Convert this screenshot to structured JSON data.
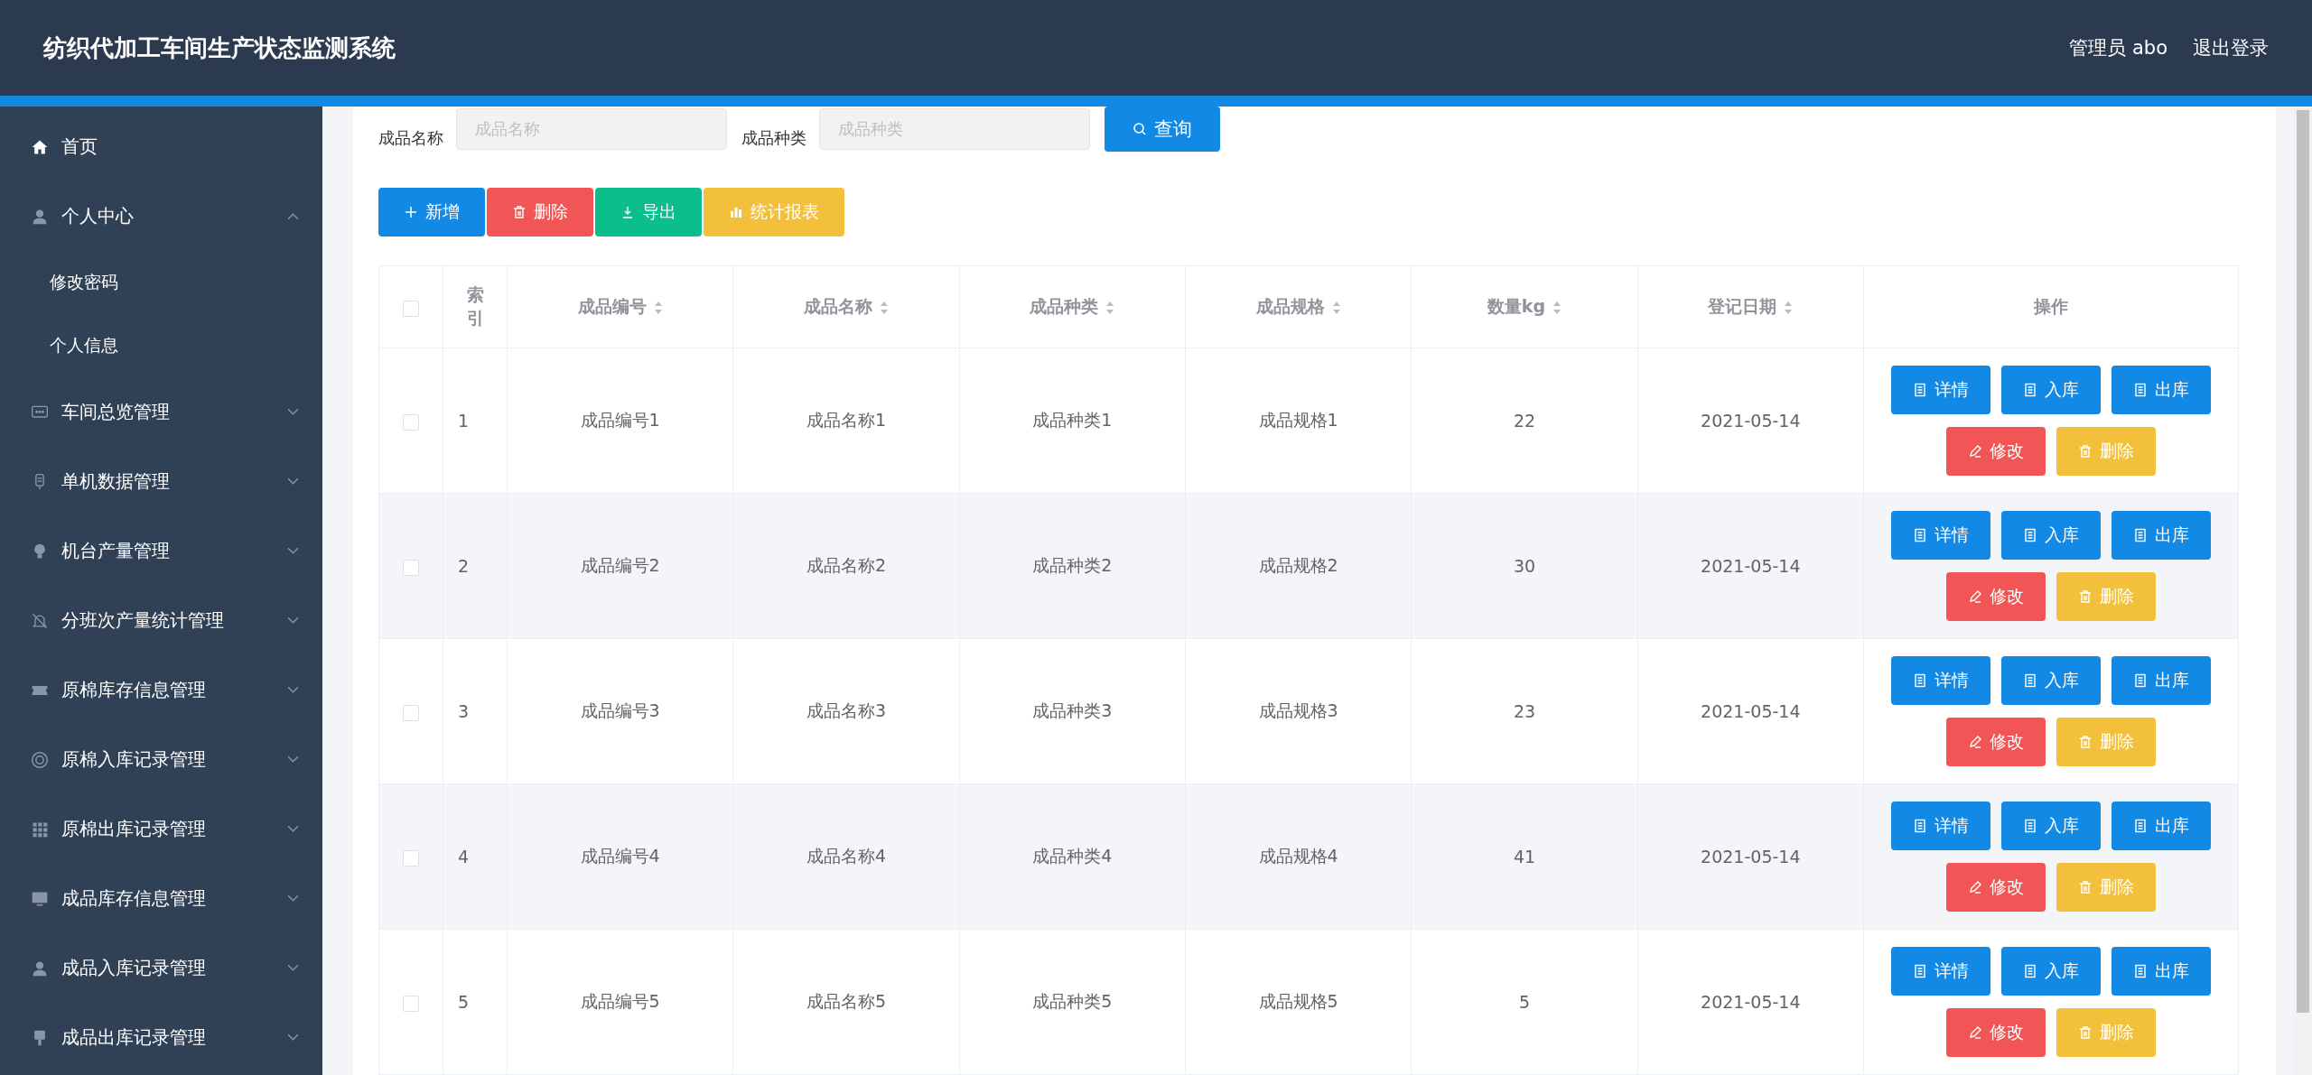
{
  "header": {
    "title": "纺织代加工车间生产状态监测系统",
    "user": "管理员 abo",
    "logout": "退出登录"
  },
  "sidebar": {
    "items": [
      {
        "label": "首页"
      },
      {
        "label": "个人中心",
        "expanded": true,
        "children": [
          {
            "label": "修改密码"
          },
          {
            "label": "个人信息"
          }
        ]
      },
      {
        "label": "车间总览管理",
        "expanded": false
      },
      {
        "label": "单机数据管理",
        "expanded": false
      },
      {
        "label": "机台产量管理",
        "expanded": false
      },
      {
        "label": "分班次产量统计管理",
        "expanded": false
      },
      {
        "label": "原棉库存信息管理",
        "expanded": false
      },
      {
        "label": "原棉入库记录管理",
        "expanded": false
      },
      {
        "label": "原棉出库记录管理",
        "expanded": false
      },
      {
        "label": "成品库存信息管理",
        "expanded": false
      },
      {
        "label": "成品入库记录管理",
        "expanded": false
      },
      {
        "label": "成品出库记录管理",
        "expanded": false
      }
    ]
  },
  "search": {
    "fields": [
      {
        "label": "成品名称",
        "placeholder": "成品名称"
      },
      {
        "label": "成品种类",
        "placeholder": "成品种类"
      }
    ],
    "button": "查询"
  },
  "toolbar": [
    {
      "label": "新增",
      "kind": "add"
    },
    {
      "label": "删除",
      "kind": "delete"
    },
    {
      "label": "导出",
      "kind": "export"
    },
    {
      "label": "统计报表",
      "kind": "report"
    }
  ],
  "table": {
    "select_all": {
      "checked": false
    },
    "columns": [
      {
        "label": "索引",
        "sortable": false
      },
      {
        "label": "成品编号",
        "sortable": true
      },
      {
        "label": "成品名称",
        "sortable": true
      },
      {
        "label": "成品种类",
        "sortable": true
      },
      {
        "label": "成品规格",
        "sortable": true
      },
      {
        "label": "数量kg",
        "sortable": true
      },
      {
        "label": "登记日期",
        "sortable": true
      },
      {
        "label": "操作",
        "sortable": false
      }
    ],
    "rows": [
      {
        "checked": false,
        "cells": [
          "1",
          "成品编号1",
          "成品名称1",
          "成品种类1",
          "成品规格1",
          "22",
          "2021-05-14"
        ],
        "actions": [
          {
            "label": "详情",
            "kind": "doc"
          },
          {
            "label": "入库",
            "kind": "doc"
          },
          {
            "label": "出库",
            "kind": "doc"
          },
          {
            "label": "修改",
            "kind": "edit"
          },
          {
            "label": "删除",
            "kind": "delete"
          }
        ]
      },
      {
        "checked": false,
        "cells": [
          "2",
          "成品编号2",
          "成品名称2",
          "成品种类2",
          "成品规格2",
          "30",
          "2021-05-14"
        ],
        "actions": [
          {
            "label": "详情",
            "kind": "doc"
          },
          {
            "label": "入库",
            "kind": "doc"
          },
          {
            "label": "出库",
            "kind": "doc"
          },
          {
            "label": "修改",
            "kind": "edit"
          },
          {
            "label": "删除",
            "kind": "delete"
          }
        ]
      },
      {
        "checked": false,
        "cells": [
          "3",
          "成品编号3",
          "成品名称3",
          "成品种类3",
          "成品规格3",
          "23",
          "2021-05-14"
        ],
        "actions": [
          {
            "label": "详情",
            "kind": "doc"
          },
          {
            "label": "入库",
            "kind": "doc"
          },
          {
            "label": "出库",
            "kind": "doc"
          },
          {
            "label": "修改",
            "kind": "edit"
          },
          {
            "label": "删除",
            "kind": "delete"
          }
        ]
      },
      {
        "checked": false,
        "cells": [
          "4",
          "成品编号4",
          "成品名称4",
          "成品种类4",
          "成品规格4",
          "41",
          "2021-05-14"
        ],
        "actions": [
          {
            "label": "详情",
            "kind": "doc"
          },
          {
            "label": "入库",
            "kind": "doc"
          },
          {
            "label": "出库",
            "kind": "doc"
          },
          {
            "label": "修改",
            "kind": "edit"
          },
          {
            "label": "删除",
            "kind": "delete"
          }
        ]
      },
      {
        "checked": false,
        "cells": [
          "5",
          "成品编号5",
          "成品名称5",
          "成品种类5",
          "成品规格5",
          "5",
          "2021-05-14"
        ],
        "actions": [
          {
            "label": "详情",
            "kind": "doc"
          },
          {
            "label": "入库",
            "kind": "doc"
          },
          {
            "label": "出库",
            "kind": "doc"
          },
          {
            "label": "修改",
            "kind": "edit"
          },
          {
            "label": "删除",
            "kind": "delete"
          }
        ]
      }
    ]
  }
}
